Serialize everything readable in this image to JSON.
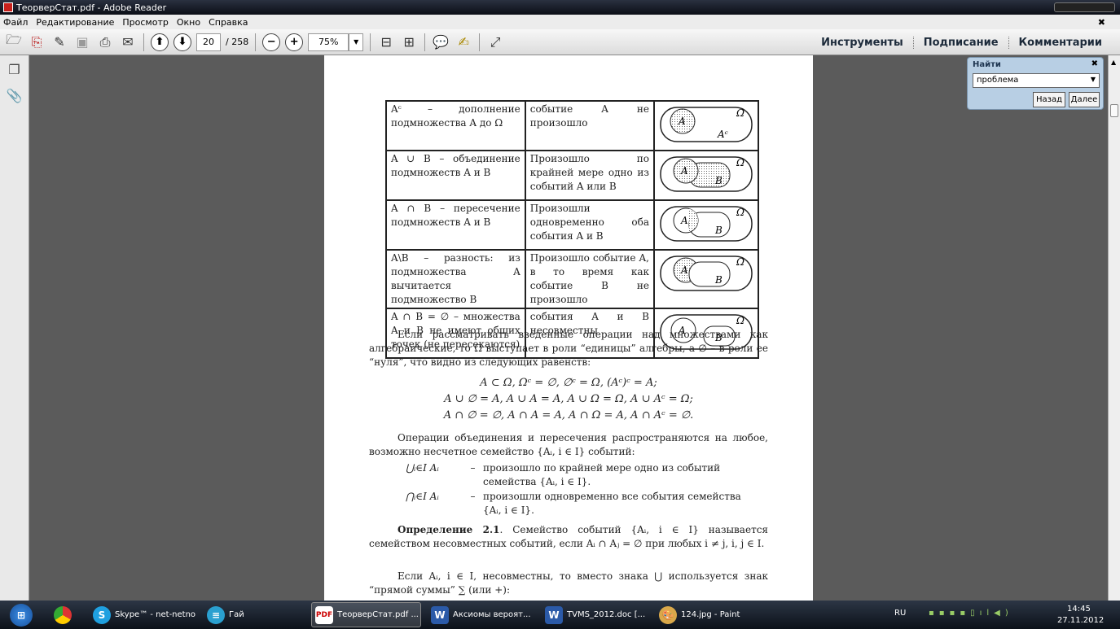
{
  "window": {
    "title": "ТеорверСтат.pdf - Adobe Reader"
  },
  "menu": [
    "Файл",
    "Редактирование",
    "Просмотр",
    "Окно",
    "Справка"
  ],
  "toolbar": {
    "page": "20",
    "total": "/ 258",
    "zoom": "75%"
  },
  "rightnav": [
    "Инструменты",
    "Подписание",
    "Комментарии"
  ],
  "find": {
    "title": "Найти",
    "value": "проблема",
    "back": "Назад",
    "next": "Далее"
  },
  "table": [
    {
      "c1": "Aᶜ – дополнение подмножества A до Ω",
      "c2": "событие A не произошло",
      "labels": [
        "A",
        "Ω",
        "Aᶜ"
      ]
    },
    {
      "c1": "A ∪ B – объединение подмножеств A и B",
      "c2": "Произошло по крайней мере одно из событий A или B",
      "labels": [
        "A",
        "B",
        "Ω"
      ]
    },
    {
      "c1": "A ∩ B – пересечение подмножеств A и B",
      "c2": "Произошли одновременно оба события A и B",
      "labels": [
        "A",
        "B",
        "Ω"
      ]
    },
    {
      "c1": "A\\B – разность: из подмножества A вычитается подмножество B",
      "c2": "Произошло событие A, в то время как событие B не произошло",
      "labels": [
        "A",
        "B",
        "Ω"
      ]
    },
    {
      "c1": "A ∩ B = ∅ – множества A и B не имеют общих точек (не пересекаются)",
      "c2": "события A и B несовместны",
      "labels": [
        "A",
        "B",
        "Ω"
      ]
    }
  ],
  "text": {
    "p1": "Если рассматривать введенные операции над множествами как алгебраические, то Ω выступает в роли “единицы” алгебры, а ∅ – в роли ее “нуля”, что видно из следующих равенств:",
    "eq1": "A ⊂ Ω,     Ωᶜ = ∅,     ∅ᶜ = Ω,     (Aᶜ)ᶜ = A;",
    "eq2": "A ∪ ∅ = A,   A ∪ A = A,   A ∪ Ω = Ω,   A ∪ Aᶜ = Ω;",
    "eq3": "A ∩ ∅ = ∅,   A ∩ A = A,   A ∩ Ω = A,   A ∩ Aᶜ = ∅.",
    "p2": "Операции объединения и пересечения распространяются на любое, возможно несчетное семейство {Aᵢ, i ∈ I} событий:",
    "d1t": "⋃ᵢ∈I Aᵢ",
    "d1": "произошло по крайней мере одно из событий семейства {Aᵢ, i ∈ I}.",
    "d2t": "⋂ᵢ∈I Aᵢ",
    "d2": "произошли одновременно все события семейства {Aᵢ, i ∈ I}.",
    "dash": "–",
    "defh": "Определение 2.1",
    "def": ". Семейство событий {Aᵢ, i ∈ I} называется семейством несовместных событий, если Aᵢ ∩ Aⱼ = ∅ при любых i ≠ j, i, j ∈ I.",
    "p3": "Если Aᵢ, i ∈ I, несовместны, то вместо знака ⋃ используется знак “прямой суммы” ∑ (или +):"
  },
  "taskbar": {
    "items": [
      "Skype™ - net-netno",
      "Гай",
      "ТеорверСтат.pdf ...",
      "Аксиомы вероят...",
      "TVMS_2012.doc [...",
      "124.jpg - Paint"
    ],
    "lang": "RU",
    "time": "14:45",
    "date": "27.11.2012"
  }
}
